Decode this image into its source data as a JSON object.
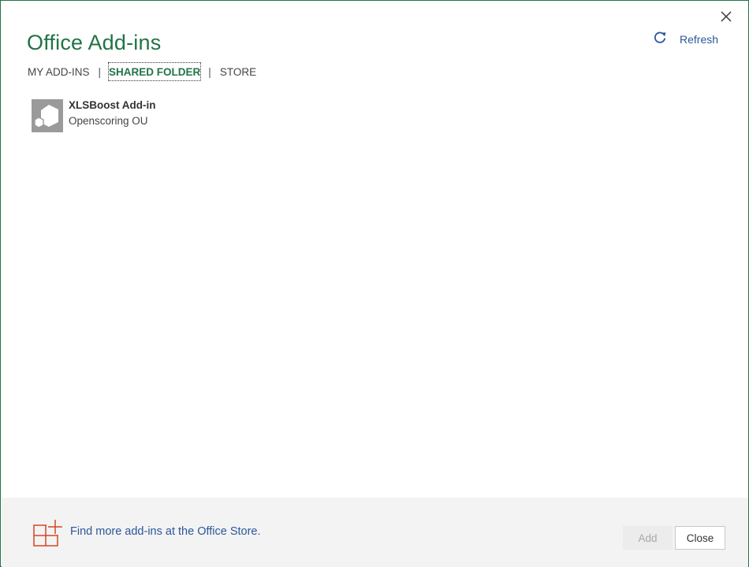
{
  "dialog": {
    "title": "Office Add-ins",
    "close_icon": "close-icon"
  },
  "refresh": {
    "label": "Refresh",
    "icon": "refresh-icon"
  },
  "tabs": [
    {
      "label": "MY ADD-INS",
      "active": false
    },
    {
      "label": "SHARED FOLDER",
      "active": true
    },
    {
      "label": "STORE",
      "active": false
    }
  ],
  "tab_separator": "|",
  "addins": [
    {
      "name": "XLSBoost Add-in",
      "publisher": "Openscoring OU",
      "icon": "addin-cube-icon"
    }
  ],
  "footer": {
    "store_link": "Find more add-ins at the Office Store.",
    "store_icon": "store-grid-plus-icon",
    "add_label": "Add",
    "add_enabled": false,
    "close_label": "Close"
  },
  "colors": {
    "accent_green": "#217346",
    "link_blue": "#2b579a",
    "store_icon_orange": "#d24726",
    "footer_bg": "#f3f3f3"
  }
}
